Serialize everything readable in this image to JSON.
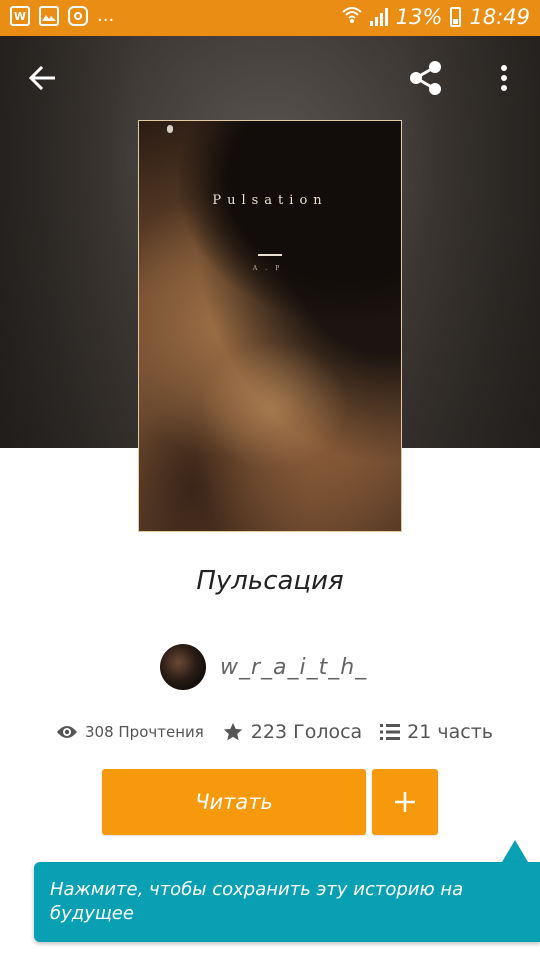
{
  "status_bar": {
    "battery_percent": "13%",
    "time": "18:49",
    "overflow": "...",
    "icons": [
      "wattpad-notification-icon",
      "gallery-icon",
      "instagram-icon",
      "wifi-icon",
      "signal-icon",
      "battery-icon"
    ],
    "color": "#e98d14"
  },
  "header": {
    "icons": [
      "back-arrow-icon",
      "share-icon",
      "more-vert-icon"
    ]
  },
  "cover": {
    "title": "Pulsation",
    "initials": "A.P"
  },
  "story": {
    "title": "Пульсация",
    "author": "w_r_a_i_t_h_"
  },
  "stats": {
    "reads": "308 Прочтения",
    "votes": "223 Голоса",
    "parts": "21 часть"
  },
  "actions": {
    "read_label": "Читать",
    "add_label": "+",
    "accent": "#f7990d"
  },
  "tooltip": {
    "text": "Нажмите, чтобы сохранить эту историю на будущее",
    "color": "#0aa0b4"
  }
}
